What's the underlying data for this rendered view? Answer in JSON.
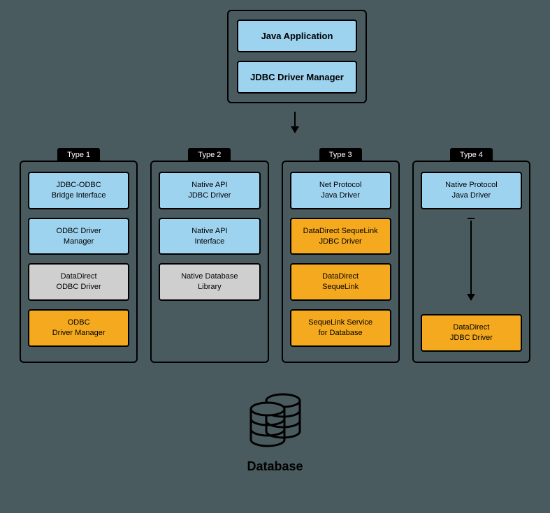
{
  "top": {
    "java_app": "Java Application",
    "driver_mgr": "JDBC Driver Manager"
  },
  "columns": [
    {
      "tab": "Type 1",
      "cells": [
        {
          "text": "JDBC-ODBC\nBridge Interface",
          "cls": "blue"
        },
        {
          "text": "ODBC Driver\nManager",
          "cls": "blue"
        },
        {
          "text": "DataDirect\nODBC Driver",
          "cls": "grey"
        },
        {
          "text": "ODBC\nDriver Manager",
          "cls": "orange"
        }
      ]
    },
    {
      "tab": "Type 2",
      "cells": [
        {
          "text": "Native API\nJDBC Driver",
          "cls": "blue"
        },
        {
          "text": "Native API\nInterface",
          "cls": "blue"
        },
        {
          "text": "Native Database\nLibrary",
          "cls": "grey"
        }
      ]
    },
    {
      "tab": "Type 3",
      "cells": [
        {
          "text": "Net Protocol\nJava Driver",
          "cls": "blue"
        },
        {
          "text": "DataDirect SequeLink\nJDBC Driver",
          "cls": "orange"
        },
        {
          "text": "DataDirect\nSequeLink",
          "cls": "orange"
        },
        {
          "text": "SequeLink Service\nfor Database",
          "cls": "orange"
        }
      ]
    },
    {
      "tab": "Type 4",
      "arrow_after": 0,
      "cells": [
        {
          "text": "Native Protocol\nJava Driver",
          "cls": "blue"
        },
        {
          "text": "DataDirect\nJDBC Driver",
          "cls": "orange"
        }
      ]
    }
  ],
  "database_label": "Database"
}
